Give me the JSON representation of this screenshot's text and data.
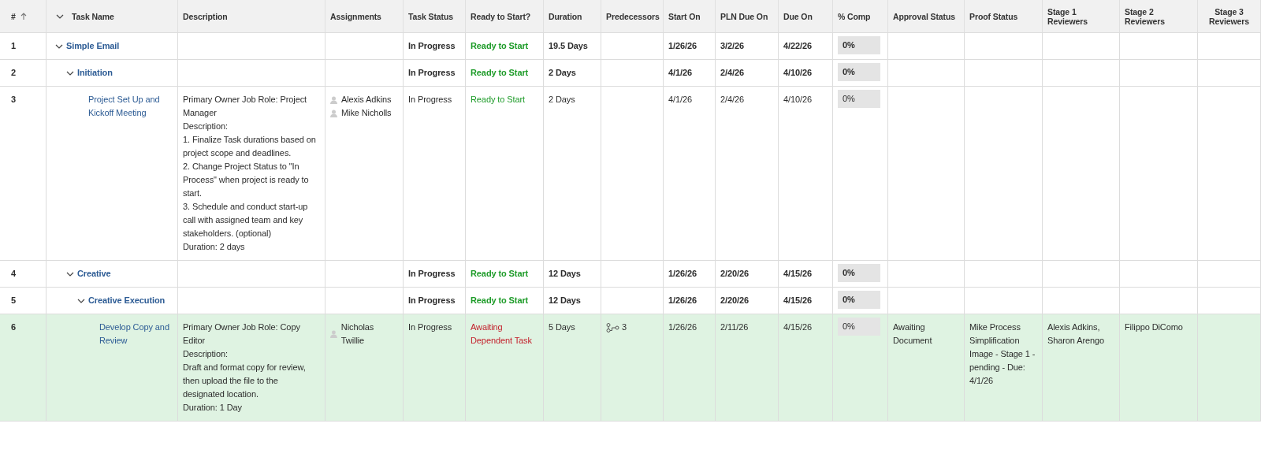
{
  "table": {
    "columns": [
      {
        "label": "#",
        "sorted_ascending": true
      },
      {
        "label": "Task Name",
        "collapsible": true
      },
      {
        "label": "Description"
      },
      {
        "label": "Assignments"
      },
      {
        "label": "Task Status"
      },
      {
        "label": "Ready to Start?"
      },
      {
        "label": "Duration"
      },
      {
        "label": "Predecessors"
      },
      {
        "label": "Start On"
      },
      {
        "label": "PLN Due On"
      },
      {
        "label": "Due On"
      },
      {
        "label": "% Comp"
      },
      {
        "label": "Approval Status"
      },
      {
        "label": "Proof Status"
      },
      {
        "label": "Stage 1 Reviewers"
      },
      {
        "label": "Stage 2 Reviewers"
      },
      {
        "label": "Stage 3 Reviewers"
      }
    ],
    "rows": [
      {
        "kind": "group",
        "number": "1",
        "name": "Simple Email",
        "expanded": true,
        "selected": false,
        "status": "In Progress",
        "ready": {
          "text": "Ready to Start",
          "kind": "ready"
        },
        "duration": "19.5 Days",
        "start": "1/26/26",
        "pln_due": "3/2/26",
        "due": "4/22/26",
        "percent": "0%",
        "children": [
          {
            "kind": "group",
            "number": "2",
            "name": "Initiation",
            "expanded": true,
            "selected": false,
            "status": "In Progress",
            "ready": {
              "text": "Ready to Start",
              "kind": "ready"
            },
            "duration": "2 Days",
            "start": "4/1/26",
            "pln_due": "2/4/26",
            "due": "4/10/26",
            "percent": "0%",
            "children": [
              {
                "kind": "task",
                "number": "3",
                "name": "Project Set Up and Kickoff Meeting",
                "selected": false,
                "description": [
                  "Primary Owner Job Role: Project Manager",
                  "Description:",
                  "1. Finalize Task durations based on project scope and deadlines.",
                  "2. Change Project Status to \"In Process\" when project is ready to start.",
                  "3. Schedule and conduct start-up call with assigned team and key stakeholders. (optional)",
                  "Duration: 2 days"
                ],
                "assignments": [
                  "Alexis Adkins",
                  "Mike Nicholls"
                ],
                "status": "In Progress",
                "ready": {
                  "text": "Ready to Start",
                  "kind": "ready"
                },
                "duration": "2 Days",
                "start": "4/1/26",
                "pln_due": "2/4/26",
                "due": "4/10/26",
                "percent": "0%"
              }
            ]
          },
          {
            "kind": "group",
            "number": "4",
            "name": "Creative",
            "expanded": true,
            "selected": false,
            "status": "In Progress",
            "ready": {
              "text": "Ready to Start",
              "kind": "ready"
            },
            "duration": "12 Days",
            "start": "1/26/26",
            "pln_due": "2/20/26",
            "due": "4/15/26",
            "percent": "0%",
            "children": [
              {
                "kind": "group",
                "number": "5",
                "name": "Creative Execution",
                "expanded": true,
                "selected": false,
                "status": "In Progress",
                "ready": {
                  "text": "Ready to Start",
                  "kind": "ready"
                },
                "duration": "12 Days",
                "start": "1/26/26",
                "pln_due": "2/20/26",
                "due": "4/15/26",
                "percent": "0%",
                "children": [
                  {
                    "kind": "task",
                    "number": "6",
                    "name": "Develop Copy and Review",
                    "selected": true,
                    "description": [
                      "Primary Owner Job Role: Copy Editor",
                      "Description:",
                      "Draft and format copy for review, then upload the file to the designated location.",
                      "Duration: 1 Day"
                    ],
                    "assignments": [
                      "Nicholas Twillie"
                    ],
                    "status": "In Progress",
                    "ready": {
                      "text": "Awaiting Dependent Task",
                      "kind": "waiting"
                    },
                    "duration": "5 Days",
                    "predecessors": "3",
                    "start": "1/26/26",
                    "pln_due": "2/11/26",
                    "due": "4/15/26",
                    "percent": "0%",
                    "approval": "Awaiting Document",
                    "proof": "Mike Process Simplification Image - Stage 1 - pending - Due: 4/1/26",
                    "stage1": "Alexis Adkins, Sharon Arengo",
                    "stage2": "Filippo DiComo"
                  }
                ]
              }
            ]
          }
        ]
      }
    ]
  }
}
